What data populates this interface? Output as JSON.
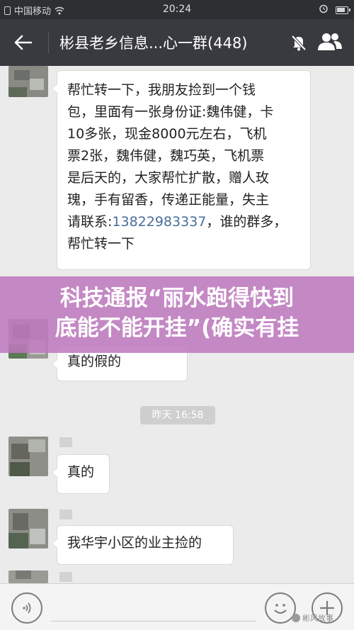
{
  "status_bar": {
    "carrier": "中国移动",
    "time": "20:24"
  },
  "header": {
    "title": "彬县老乡信息...心一群(448)"
  },
  "messages": [
    {
      "lines": [
        "帮忙转一下，我朋友捡到一个钱",
        "包，里面有一张身份证:魏伟健，卡",
        "10多张，现金8000元左右，飞机",
        "票2张，魏伟健，魏巧英，飞机票",
        "是后天的，大家帮忙扩散，赠人玫",
        "瑰，手有留香，传递正能量，失主"
      ],
      "contact_prefix": "请联系:",
      "phone": "13822983337",
      "contact_suffix": "，谁的群多，",
      "last_line": "帮忙转一下"
    },
    {
      "text": "真的假的"
    },
    {
      "text": "真的"
    },
    {
      "text": "我华宇小区的业主捡的"
    }
  ],
  "timestamp": "昨天 16:58",
  "banner": {
    "line1": "科技通报“丽水跑得快到",
    "line2": "底能不能开挂”(确实有挂"
  },
  "watermark": "彬风故事",
  "colors": {
    "status_bar_bg": "#2d2f33",
    "header_bg": "#393a3f",
    "chat_bg": "#ebebeb",
    "banner_bg": "#be78be",
    "link_color": "#4a6d9a"
  }
}
